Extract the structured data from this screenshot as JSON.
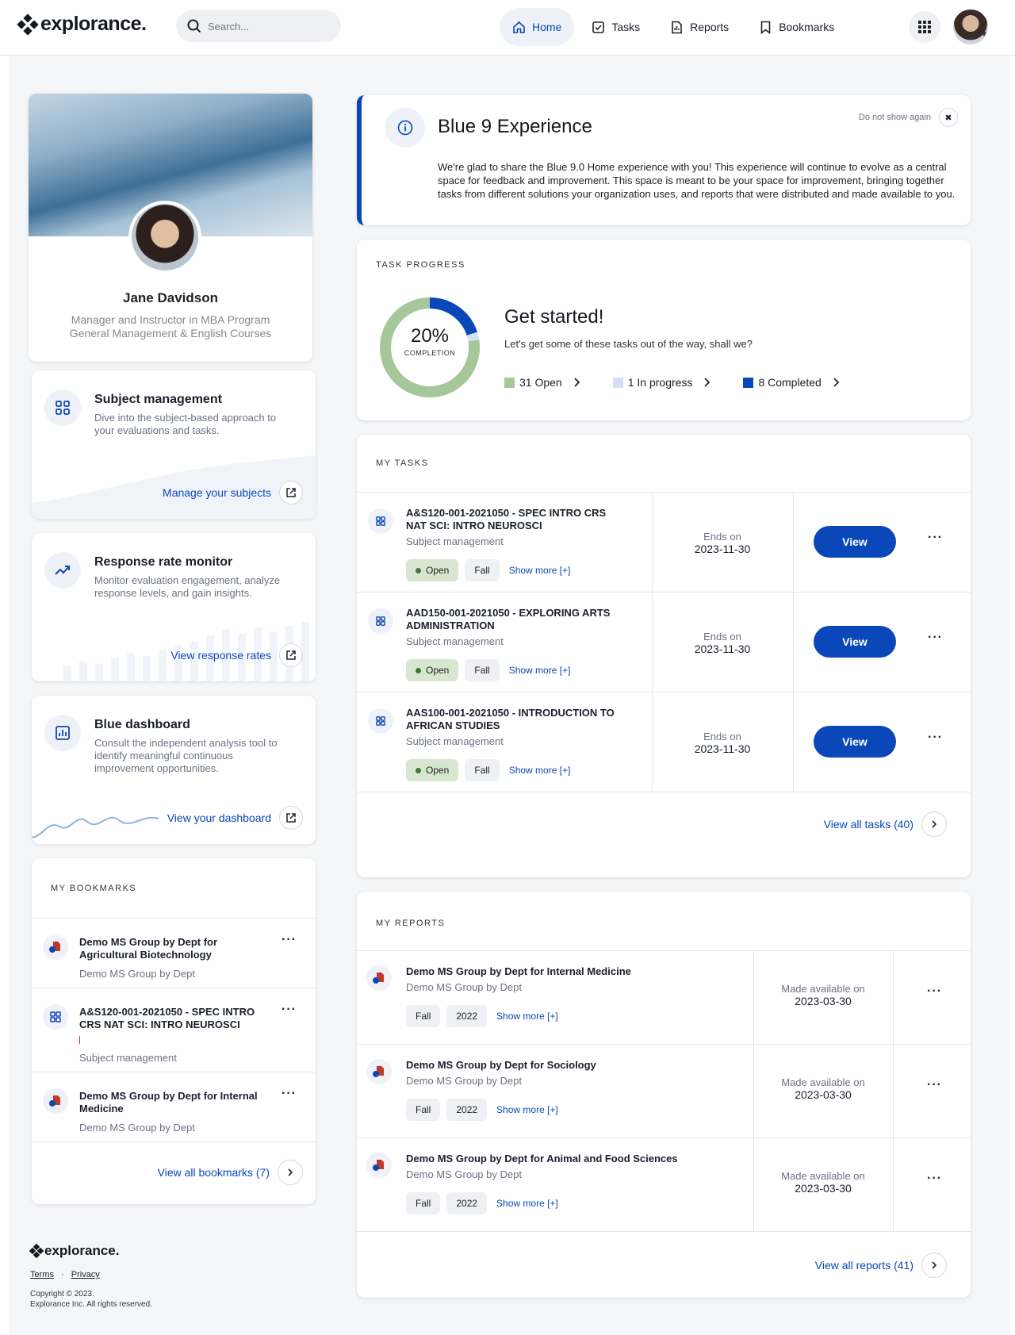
{
  "brand": {
    "name": "explorance."
  },
  "search": {
    "placeholder": "Search..."
  },
  "nav": {
    "home": "Home",
    "tasks": "Tasks",
    "reports": "Reports",
    "bookmarks": "Bookmarks"
  },
  "profile": {
    "name": "Jane Davidson",
    "role_line1": "Manager and Instructor in MBA Program",
    "role_line2": "General Management & English Courses"
  },
  "features": [
    {
      "title": "Subject management",
      "desc": "Dive into the subject-based approach to your evaluations and tasks.",
      "link": "Manage your subjects"
    },
    {
      "title": "Response rate monitor",
      "desc": "Monitor evaluation engagement, analyze response levels, and gain insights.",
      "link": "View response rates"
    },
    {
      "title": "Blue dashboard",
      "desc": "Consult the independent analysis tool to identify meaningful continuous improvement opportunities.",
      "link": "View your dashboard"
    }
  ],
  "bookmarks": {
    "label": "MY BOOKMARKS",
    "items": [
      {
        "title": "Demo MS Group by Dept for Agricultural Biotechnology",
        "sub": "Demo MS Group by Dept"
      },
      {
        "title": "A&S120-001-2021050 - SPEC INTRO CRS NAT SCI: INTRO NEUROSCI",
        "sub": "Subject management"
      },
      {
        "title": "Demo MS Group by Dept for Internal Medicine",
        "sub": "Demo MS Group by Dept"
      }
    ],
    "view_all": "View all bookmarks (7)"
  },
  "footer": {
    "terms": "Terms",
    "privacy": "Privacy",
    "copyright1": "Copyright © 2023.",
    "copyright2": "Explorance Inc. All rights reserved."
  },
  "banner": {
    "title": "Blue 9 Experience",
    "dismiss": "Do not show again",
    "text": "We're glad to share the Blue 9.0 Home experience with you! This experience will continue to evolve as a central space for feedback and improvement. This space is meant to be your space for improvement, bringing together tasks from different solutions your organization uses, and reports that were distributed and made available to you."
  },
  "task_progress": {
    "label": "TASK PROGRESS",
    "percent": "20%",
    "completion": "COMPLETION",
    "heading": "Get started!",
    "subtext": "Let's get some of these tasks out of the way, shall we?",
    "open": "31 Open",
    "in_progress": "1 In progress",
    "completed": "8 Completed",
    "counts": {
      "open": 31,
      "in_progress": 1,
      "completed": 8
    },
    "colors": {
      "open": "#a6c79a",
      "in_progress": "#d3e2f2",
      "completed": "#0a47b8"
    }
  },
  "tasks": {
    "label": "MY TASKS",
    "items": [
      {
        "title": "A&S120-001-2021050 - SPEC INTRO CRS NAT SCI: INTRO NEUROSCI",
        "sub": "Subject management",
        "status": "Open",
        "term": "Fall",
        "more": "Show more [+]",
        "ends_label": "Ends on",
        "ends": "2023-11-30",
        "action": "View"
      },
      {
        "title": "AAD150-001-2021050 - EXPLORING ARTS ADMINISTRATION",
        "sub": "Subject management",
        "status": "Open",
        "term": "Fall",
        "more": "Show more [+]",
        "ends_label": "Ends on",
        "ends": "2023-11-30",
        "action": "View"
      },
      {
        "title": "AAS100-001-2021050 - INTRODUCTION TO AFRICAN STUDIES",
        "sub": "Subject management",
        "status": "Open",
        "term": "Fall",
        "more": "Show more [+]",
        "ends_label": "Ends on",
        "ends": "2023-11-30",
        "action": "View"
      }
    ],
    "view_all": "View all tasks (40)"
  },
  "reports": {
    "label": "MY REPORTS",
    "items": [
      {
        "title": "Demo MS Group by Dept for Internal Medicine",
        "sub": "Demo MS Group by Dept",
        "term": "Fall",
        "year": "2022",
        "more": "Show more [+]",
        "avail_label": "Made available on",
        "avail": "2023-03-30"
      },
      {
        "title": "Demo MS Group by Dept for Sociology",
        "sub": "Demo MS Group by Dept",
        "term": "Fall",
        "year": "2022",
        "more": "Show more [+]",
        "avail_label": "Made available on",
        "avail": "2023-03-30"
      },
      {
        "title": "Demo MS Group by Dept for Animal and Food Sciences",
        "sub": "Demo MS Group by Dept",
        "term": "Fall",
        "year": "2022",
        "more": "Show more [+]",
        "avail_label": "Made available on",
        "avail": "2023-03-30"
      }
    ],
    "view_all": "View all reports (41)"
  }
}
